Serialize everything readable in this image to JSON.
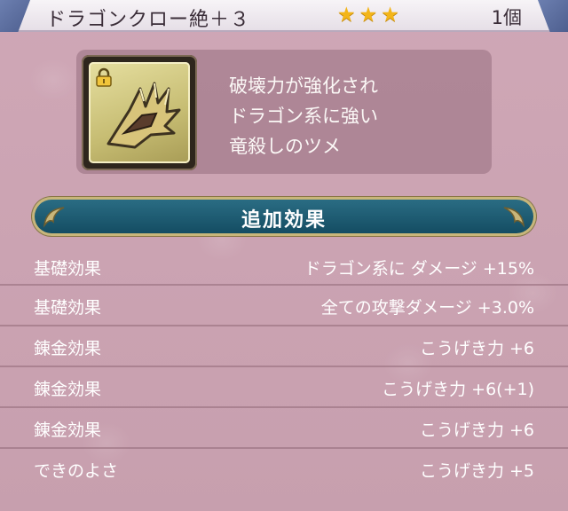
{
  "header": {
    "item_name": "ドラゴンクロー絶＋３",
    "stars": 3,
    "count": "1個"
  },
  "item": {
    "icon": "dragon-claw-icon",
    "locked": true,
    "description": [
      "破壊力が強化され",
      "ドラゴン系に強い",
      "竜殺しのツメ"
    ]
  },
  "section": {
    "title": "追加効果"
  },
  "effects": [
    {
      "label": "基礎効果",
      "value": "ドラゴン系に ダメージ +15%"
    },
    {
      "label": "基礎効果",
      "value": "全ての攻撃ダメージ +3.0%"
    },
    {
      "label": "錬金効果",
      "value": "こうげき力 +6"
    },
    {
      "label": "錬金効果",
      "value": "こうげき力 +6(+1)"
    },
    {
      "label": "錬金効果",
      "value": "こうげき力 +6"
    },
    {
      "label": "できのよさ",
      "value": "こうげき力 +5"
    }
  ],
  "colors": {
    "background": "#caa3b2",
    "banner": "#1d5c74",
    "star": "#f3b519"
  }
}
